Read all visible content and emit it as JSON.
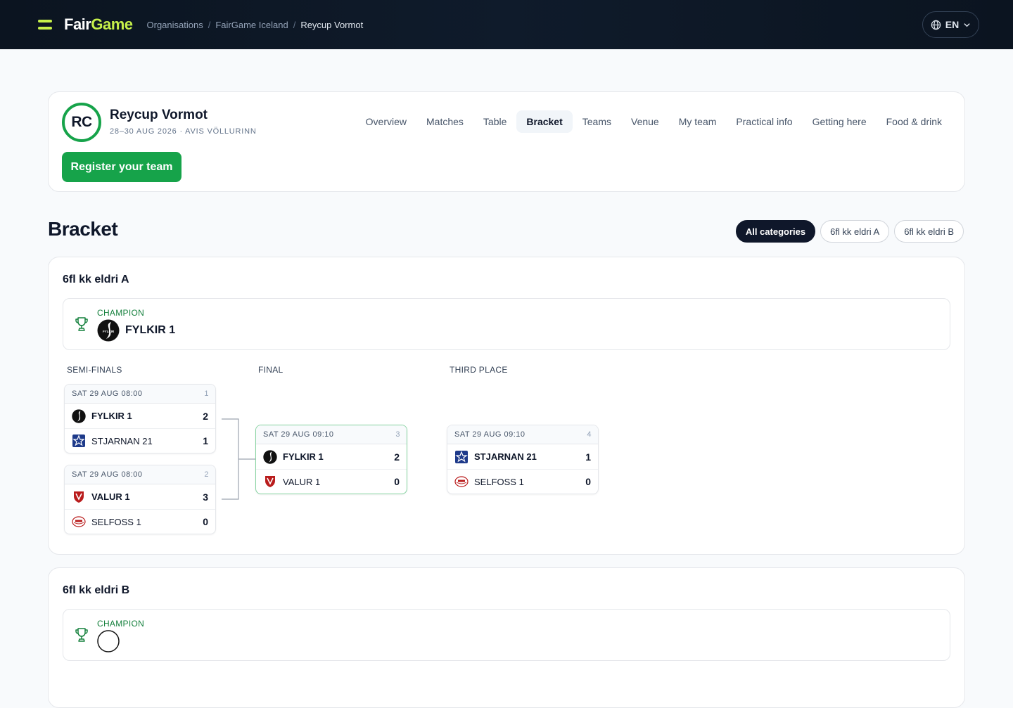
{
  "topbar": {
    "logo_part1": "Fair",
    "logo_part2": "Game",
    "breadcrumbs": [
      "Organisations",
      "FairGame Iceland",
      "Reycup Vormot"
    ],
    "language": "EN",
    "accent": "#c6f04a"
  },
  "tournament": {
    "badge": "RC",
    "name": "Reycup Vormot",
    "meta": "28–30 AUG 2026 · AVIS VÖLLURINN",
    "register_label": "Register your team",
    "tabs": [
      "Overview",
      "Matches",
      "Table",
      "Bracket",
      "Teams",
      "Venue",
      "My team",
      "Practical info",
      "Getting here",
      "Food & drink"
    ],
    "active_tab": "Bracket"
  },
  "section": {
    "title": "Bracket",
    "filters": [
      "All categories",
      "6fl kk eldri A",
      "6fl kk eldri B"
    ],
    "active_filter": "All categories"
  },
  "categories": [
    {
      "title": "6fl kk eldri A",
      "champion_label": "CHAMPION",
      "champion": "FYLKIR 1",
      "rounds": [
        "SEMI-FINALS",
        "FINAL",
        "THIRD PLACE"
      ],
      "matches": [
        {
          "time": "SAT 29 AUG 08:00",
          "num": "1",
          "home": "FYLKIR 1",
          "home_score": "2",
          "home_crest": "fylkir-crest-icon",
          "away": "STJARNAN 21",
          "away_score": "1",
          "away_crest": "stjarnan-crest-icon"
        },
        {
          "time": "SAT 29 AUG 08:00",
          "num": "2",
          "home": "VALUR 1",
          "home_score": "3",
          "home_crest": "valur-crest-icon",
          "away": "SELFOSS 1",
          "away_score": "0",
          "away_crest": "selfoss-crest-icon"
        },
        {
          "time": "SAT 29 AUG 09:10",
          "num": "3",
          "home": "FYLKIR 1",
          "home_score": "2",
          "home_crest": "fylkir-crest-icon",
          "away": "VALUR 1",
          "away_score": "0",
          "away_crest": "valur-crest-icon"
        },
        {
          "time": "SAT 29 AUG 09:10",
          "num": "4",
          "home": "STJARNAN 21",
          "home_score": "1",
          "home_crest": "stjarnan-crest-icon",
          "away": "SELFOSS 1",
          "away_score": "0",
          "away_crest": "selfoss-crest-icon"
        }
      ]
    },
    {
      "title": "6fl kk eldri B",
      "champion_label": "CHAMPION"
    }
  ]
}
